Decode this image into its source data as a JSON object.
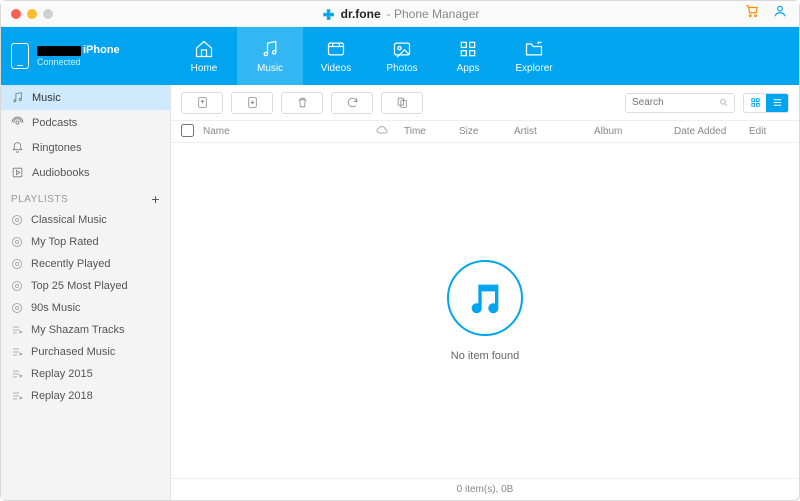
{
  "title": {
    "brand": "dr.fone",
    "sub": "- Phone Manager"
  },
  "device": {
    "name_suffix": "iPhone",
    "status": "Connected"
  },
  "nav": {
    "home": "Home",
    "music": "Music",
    "videos": "Videos",
    "photos": "Photos",
    "apps": "Apps",
    "explorer": "Explorer"
  },
  "sidebar": {
    "library": {
      "music": "Music",
      "podcasts": "Podcasts",
      "ringtones": "Ringtones",
      "audiobooks": "Audiobooks"
    },
    "playlists_header": "PLAYLISTS",
    "playlists": [
      "Classical Music",
      "My Top Rated",
      "Recently Played",
      "Top 25 Most Played",
      "90s Music",
      "My Shazam Tracks",
      "Purchased Music",
      "Replay 2015",
      "Replay 2018"
    ]
  },
  "columns": {
    "name": "Name",
    "time": "Time",
    "size": "Size",
    "artist": "Artist",
    "album": "Album",
    "date": "Date Added",
    "edit": "Edit"
  },
  "search_placeholder": "Search",
  "empty_text": "No item found",
  "status_text": "0 item(s), 0B"
}
